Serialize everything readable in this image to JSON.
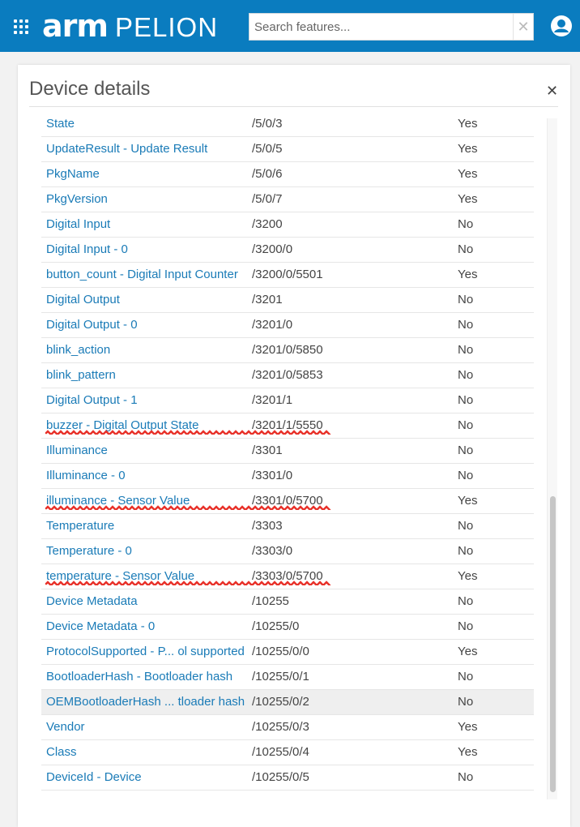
{
  "app": {
    "logo_arm": "arm",
    "logo_pelion": "PELION"
  },
  "search": {
    "placeholder": "Search features...",
    "value": ""
  },
  "panel": {
    "title": "Device details"
  },
  "colors": {
    "topbar": "#0a7cbf",
    "link": "#1a7bb7",
    "annotation": "#e8322a"
  },
  "rows": [
    {
      "name": "State",
      "path": "/5/0/3",
      "observable": "Yes"
    },
    {
      "name": "UpdateResult - Update Result",
      "path": "/5/0/5",
      "observable": "Yes"
    },
    {
      "name": "PkgName",
      "path": "/5/0/6",
      "observable": "Yes"
    },
    {
      "name": "PkgVersion",
      "path": "/5/0/7",
      "observable": "Yes"
    },
    {
      "name": "Digital Input",
      "path": "/3200",
      "observable": "No"
    },
    {
      "name": "Digital Input - 0",
      "path": "/3200/0",
      "observable": "No"
    },
    {
      "name": "button_count - Digital Input Counter",
      "path": "/3200/0/5501",
      "observable": "Yes"
    },
    {
      "name": "Digital Output",
      "path": "/3201",
      "observable": "No"
    },
    {
      "name": "Digital Output - 0",
      "path": "/3201/0",
      "observable": "No"
    },
    {
      "name": "blink_action",
      "path": "/3201/0/5850",
      "observable": "No"
    },
    {
      "name": "blink_pattern",
      "path": "/3201/0/5853",
      "observable": "No"
    },
    {
      "name": "Digital Output - 1",
      "path": "/3201/1",
      "observable": "No"
    },
    {
      "name": "buzzer - Digital Output State",
      "path": "/3201/1/5550",
      "observable": "No"
    },
    {
      "name": "Illuminance",
      "path": "/3301",
      "observable": "No"
    },
    {
      "name": "Illuminance - 0",
      "path": "/3301/0",
      "observable": "No"
    },
    {
      "name": "illuminance - Sensor Value",
      "path": "/3301/0/5700",
      "observable": "Yes"
    },
    {
      "name": "Temperature",
      "path": "/3303",
      "observable": "No"
    },
    {
      "name": "Temperature - 0",
      "path": "/3303/0",
      "observable": "No"
    },
    {
      "name": "temperature - Sensor Value",
      "path": "/3303/0/5700",
      "observable": "Yes"
    },
    {
      "name": "Device Metadata",
      "path": "/10255",
      "observable": "No"
    },
    {
      "name": "Device Metadata - 0",
      "path": "/10255/0",
      "observable": "No"
    },
    {
      "name": "ProtocolSupported - P... ol supported",
      "path": "/10255/0/0",
      "observable": "Yes"
    },
    {
      "name": "BootloaderHash - Bootloader hash",
      "path": "/10255/0/1",
      "observable": "No"
    },
    {
      "name": "OEMBootloaderHash ... tloader hash",
      "path": "/10255/0/2",
      "observable": "No"
    },
    {
      "name": "Vendor",
      "path": "/10255/0/3",
      "observable": "Yes"
    },
    {
      "name": "Class",
      "path": "/10255/0/4",
      "observable": "Yes"
    },
    {
      "name": "DeviceId - Device",
      "path": "/10255/0/5",
      "observable": "No"
    }
  ]
}
